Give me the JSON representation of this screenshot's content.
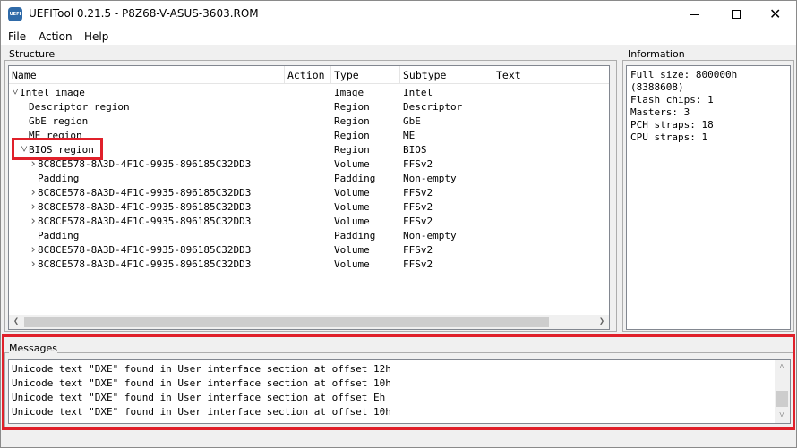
{
  "window": {
    "title": "UEFITool 0.21.5 - P8Z68-V-ASUS-3603.ROM",
    "icon_label": "UEFI",
    "controls": [
      "minimize-icon",
      "maximize-icon",
      "close-icon"
    ],
    "close_glyph": "✕"
  },
  "menu": {
    "file": "File",
    "action": "Action",
    "help": "Help"
  },
  "structure": {
    "title": "Structure",
    "columns": {
      "name": "Name",
      "action": "Action",
      "type": "Type",
      "subtype": "Subtype",
      "text": "Text"
    },
    "rows": [
      {
        "name": "Intel image",
        "action": "",
        "type": "Image",
        "subtype": "Intel",
        "arrow": "expanded"
      },
      {
        "name": "Descriptor region",
        "action": "",
        "type": "Region",
        "subtype": "Descriptor",
        "arrow": "none"
      },
      {
        "name": "GbE region",
        "action": "",
        "type": "Region",
        "subtype": "GbE",
        "arrow": "none"
      },
      {
        "name": "ME region",
        "action": "",
        "type": "Region",
        "subtype": "ME",
        "arrow": "none"
      },
      {
        "name": "BIOS region",
        "action": "",
        "type": "Region",
        "subtype": "BIOS",
        "arrow": "expanded",
        "highlighted": true
      },
      {
        "name": "8C8CE578-8A3D-4F1C-9935-896185C32DD3",
        "action": "",
        "type": "Volume",
        "subtype": "FFSv2",
        "arrow": "collapsed"
      },
      {
        "name": "Padding",
        "action": "",
        "type": "Padding",
        "subtype": "Non-empty",
        "arrow": "none"
      },
      {
        "name": "8C8CE578-8A3D-4F1C-9935-896185C32DD3",
        "action": "",
        "type": "Volume",
        "subtype": "FFSv2",
        "arrow": "collapsed"
      },
      {
        "name": "8C8CE578-8A3D-4F1C-9935-896185C32DD3",
        "action": "",
        "type": "Volume",
        "subtype": "FFSv2",
        "arrow": "collapsed"
      },
      {
        "name": "8C8CE578-8A3D-4F1C-9935-896185C32DD3",
        "action": "",
        "type": "Volume",
        "subtype": "FFSv2",
        "arrow": "collapsed"
      },
      {
        "name": "Padding",
        "action": "",
        "type": "Padding",
        "subtype": "Non-empty",
        "arrow": "none"
      },
      {
        "name": "8C8CE578-8A3D-4F1C-9935-896185C32DD3",
        "action": "",
        "type": "Volume",
        "subtype": "FFSv2",
        "arrow": "collapsed"
      },
      {
        "name": "8C8CE578-8A3D-4F1C-9935-896185C32DD3",
        "action": "",
        "type": "Volume",
        "subtype": "FFSv2",
        "arrow": "collapsed"
      }
    ]
  },
  "information": {
    "title": "Information",
    "lines": [
      "Full size: 800000h",
      "(8388608)",
      "Flash chips: 1",
      "Masters: 3",
      "PCH straps: 18",
      "CPU straps: 1"
    ]
  },
  "messages": {
    "title": "Messages",
    "lines": [
      "Unicode text \"DXE\" found in User interface section at offset 12h",
      "Unicode text \"DXE\" found in User interface section at offset 10h",
      "Unicode text \"DXE\" found in User interface section at offset Eh",
      "Unicode text \"DXE\" found in User interface section at offset 10h"
    ],
    "highlighted": true
  },
  "colors": {
    "highlight": "#e0202a",
    "window_bg": "#f0f0f0",
    "panel_bg": "#ffffff"
  }
}
